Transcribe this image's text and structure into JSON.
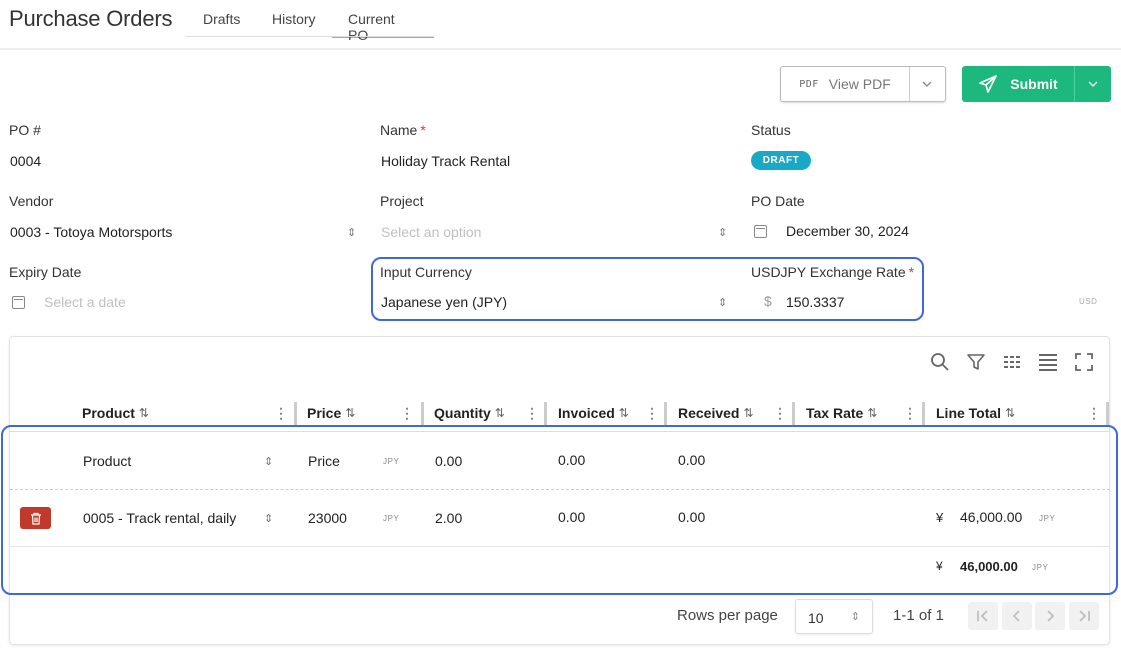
{
  "header": {
    "title": "Purchase Orders",
    "tabs": [
      {
        "label": "Drafts"
      },
      {
        "label": "History"
      },
      {
        "label": "Current PO"
      }
    ],
    "active_tab": "Current PO"
  },
  "actions": {
    "pdf_icon": "PDF",
    "view_pdf_label": "View PDF",
    "submit_label": "Submit"
  },
  "form": {
    "po_number": {
      "label": "PO #",
      "value": "0004"
    },
    "name": {
      "label": "Name",
      "required_mark": "*",
      "value": "Holiday Track Rental"
    },
    "status": {
      "label": "Status",
      "value": "DRAFT"
    },
    "vendor": {
      "label": "Vendor",
      "value": "0003 - Totoya Motorsports"
    },
    "project": {
      "label": "Project",
      "placeholder": "Select an option"
    },
    "po_date": {
      "label": "PO Date",
      "value": "December 30, 2024"
    },
    "expiry_date": {
      "label": "Expiry Date",
      "placeholder": "Select a date"
    },
    "input_currency": {
      "label": "Input Currency",
      "value": "Japanese yen (JPY)"
    },
    "exchange_rate": {
      "label": "USDJPY Exchange Rate",
      "required_mark": "*",
      "prefix": "$",
      "value": "150.3337",
      "suffix": "USD"
    }
  },
  "table": {
    "columns": [
      "Product",
      "Price",
      "Quantity",
      "Invoiced",
      "Received",
      "Tax Rate",
      "Line Total"
    ],
    "sort_glyph": "⇅",
    "new_row": {
      "product_placeholder": "Product",
      "price_placeholder": "Price",
      "currency": "JPY",
      "quantity": "0.00",
      "invoiced": "0.00",
      "received": "0.00"
    },
    "rows": [
      {
        "product": "0005 - Track rental, daily",
        "price": "23000",
        "currency": "JPY",
        "quantity": "2.00",
        "invoiced": "0.00",
        "received": "0.00",
        "line_total_symbol": "¥",
        "line_total": "46,000.00",
        "line_total_currency": "JPY"
      }
    ],
    "total": {
      "symbol": "¥",
      "value": "46,000.00",
      "currency": "JPY"
    }
  },
  "pagination": {
    "rows_per_page_label": "Rows per page",
    "rows_per_page": "10",
    "range": "1-1 of 1"
  },
  "colors": {
    "accent": "#1db87d",
    "badge": "#19a9c6",
    "highlight": "#3f68e0",
    "danger": "#c0392b"
  }
}
